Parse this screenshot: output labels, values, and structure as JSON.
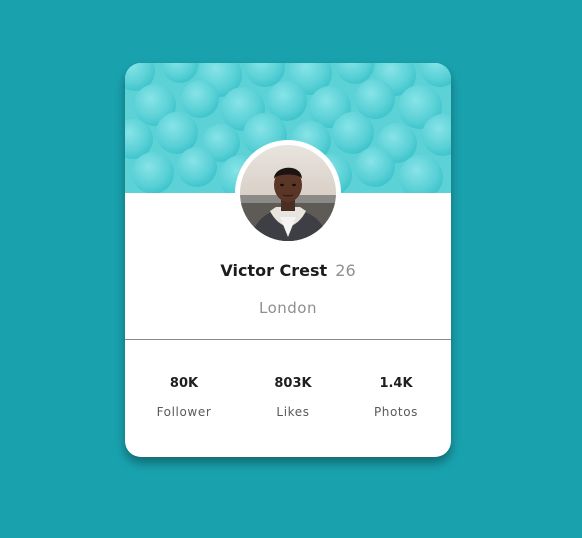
{
  "profile": {
    "name": "Victor Crest",
    "age": "26",
    "city": "London"
  },
  "stats": [
    {
      "value": "80K",
      "label": "Follower"
    },
    {
      "value": "803K",
      "label": "Likes"
    },
    {
      "value": "1.4K",
      "label": "Photos"
    }
  ],
  "colors": {
    "background": "#19a2ae",
    "banner": "#5fd3d8",
    "card": "#ffffff"
  }
}
